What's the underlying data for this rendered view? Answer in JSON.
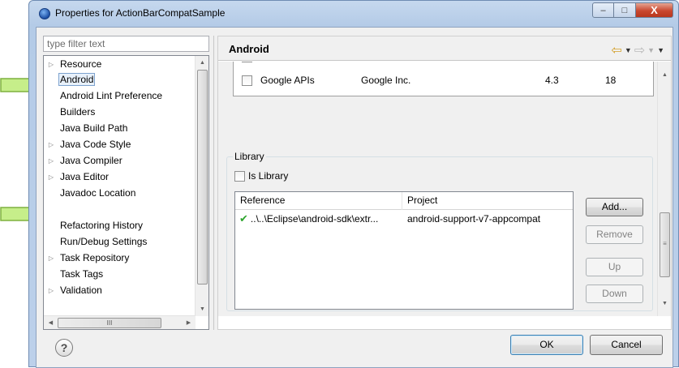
{
  "window": {
    "title": "Properties for ActionBarCompatSample",
    "min_label": "–",
    "max_label": "□",
    "close_label": "X"
  },
  "filter": {
    "placeholder": "type filter text",
    "value": ""
  },
  "tree": {
    "items": [
      {
        "label": "Resource",
        "expandable": true
      },
      {
        "label": "Android",
        "expandable": false,
        "selected": true
      },
      {
        "label": "Android Lint Preference",
        "expandable": false
      },
      {
        "label": "Builders",
        "expandable": false
      },
      {
        "label": "Java Build Path",
        "expandable": false
      },
      {
        "label": "Java Code Style",
        "expandable": true
      },
      {
        "label": "Java Compiler",
        "expandable": true
      },
      {
        "label": "Java Editor",
        "expandable": true
      },
      {
        "label": "Javadoc Location",
        "expandable": false
      },
      {
        "label": "",
        "expandable": false
      },
      {
        "label": "Refactoring History",
        "expandable": false
      },
      {
        "label": "Run/Debug Settings",
        "expandable": false
      },
      {
        "label": "Task Repository",
        "expandable": true
      },
      {
        "label": "Task Tags",
        "expandable": false
      },
      {
        "label": "Validation",
        "expandable": true
      }
    ],
    "hscroll_thumb_label": "III"
  },
  "page": {
    "title": "Android",
    "nav": {
      "back_icon": "⇦",
      "forward_icon": "⇨",
      "dropdown_icon": "▼",
      "menu_icon": "▼"
    }
  },
  "target": {
    "name": "Google APIs",
    "vendor": "Google Inc.",
    "platform": "4.3",
    "api": "18"
  },
  "library": {
    "group_label": "Library",
    "is_library_label": "Is Library",
    "columns": {
      "reference": "Reference",
      "project": "Project"
    },
    "rows": [
      {
        "reference": "..\\..\\Eclipse\\android-sdk\\extr...",
        "project": "android-support-v7-appcompat"
      }
    ],
    "buttons": {
      "add": "Add...",
      "remove": "Remove",
      "up": "Up",
      "down": "Down"
    }
  },
  "footer": {
    "help": "?",
    "ok": "OK",
    "cancel": "Cancel"
  },
  "colors": {
    "arrow_fill": "#c6ee8a",
    "arrow_border": "#7fb13f",
    "check": "#2ea52e"
  }
}
